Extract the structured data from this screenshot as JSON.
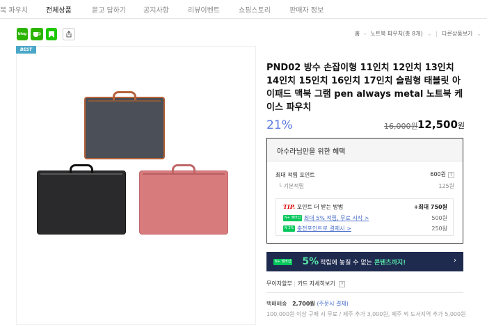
{
  "nav": [
    "북 파우치",
    "전체상품",
    "묻고 답하기",
    "공지사항",
    "리뷰이벤트",
    "쇼핑스토리",
    "판매자 정보"
  ],
  "share": {
    "blog_label": "blog"
  },
  "breadcrumb": {
    "home": "홈",
    "category": "노트북 파우치(총 8개)",
    "sort": "다른상품보기"
  },
  "badge": "BEST",
  "product": {
    "title": "PND02 방수 손잡이형 11인치 12인치 13인치 14인치 15인치 16인치 17인치 슬림형 태블릿 아이패드 맥북 그램 pen always metal 노트북 케이스 파우치",
    "discount": "21%",
    "original_price": "16,000원",
    "sale_price": "12,500",
    "currency": "원"
  },
  "benefit": {
    "heading": "아수라님만을 위한 혜택",
    "max_points_label": "최대 적립 포인트",
    "max_points_value": "600원",
    "basic_label": "기본적립",
    "basic_value": "125원",
    "tip_label": "TIP.",
    "tip_text": "포인트 더 받는 방법",
    "tip_value": "+최대 750원",
    "tip_item1_badge": "N+ 멤버십",
    "tip_item1": "최대 5% 적립, 무료 시작 >",
    "tip_item1_value": "500원",
    "tip_item2_badge": "N 2%",
    "tip_item2": "충전포인트로 결제시 >",
    "tip_item2_value": "250원"
  },
  "banner": {
    "badge": "N+ 멤버십",
    "pct": "5%",
    "text": "적립에 놓칠 수 없는",
    "highlight": "콘텐츠까지!"
  },
  "payment": {
    "label1": "무이자할부",
    "label2": "카드 자세히보기"
  },
  "shipping": {
    "label": "택배배송",
    "fee": "2,700원",
    "note": "(주문시 결제)",
    "detail": "100,000원 이상 구매 시 무료 / 제주 추가 3,000원, 제주 외 도서지역 추가 5,000원"
  },
  "colors": {
    "accent_blue": "#5b7be0",
    "naver_green": "#03c75a",
    "banner_bg": "#1f2a4f"
  }
}
